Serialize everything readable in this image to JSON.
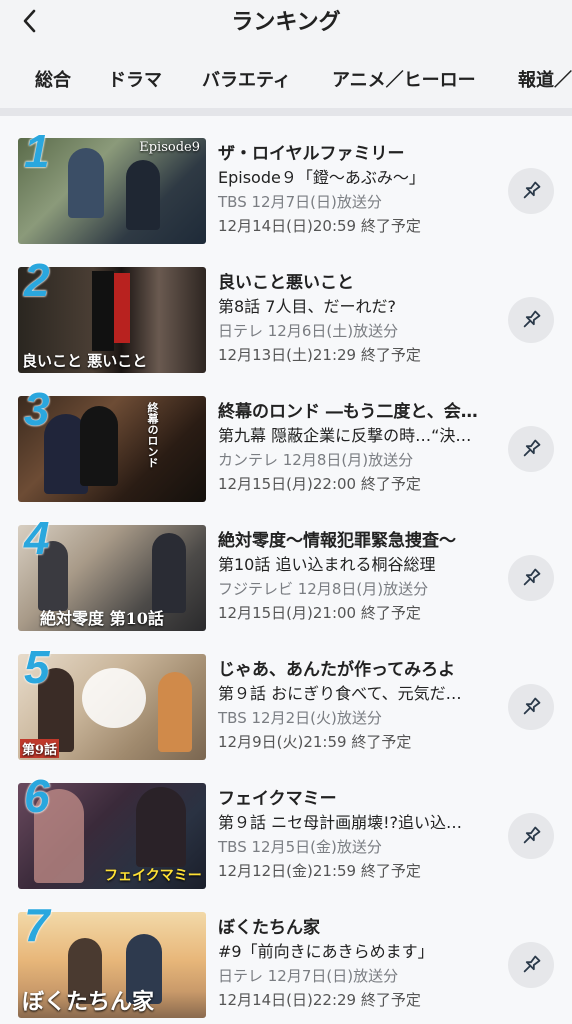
{
  "header": {
    "title": "ランキング"
  },
  "tabs": [
    {
      "label": "総合"
    },
    {
      "label": "ドラマ"
    },
    {
      "label": "バラエティ"
    },
    {
      "label": "アニメ／ヒーロー"
    },
    {
      "label": "報道／"
    }
  ],
  "active_tab": "ドラマ",
  "accent_color": "#19a4e0",
  "rank_color": "#2aa7de",
  "items": [
    {
      "rank": "1",
      "title": "ザ・ロイヤルファミリー",
      "episode": "Episode９「鐙〜あぶみ〜」",
      "broadcast": "TBS 12月7日(日)放送分",
      "expires": "12月14日(日)20:59 終了予定",
      "thumb_text": "Episode9"
    },
    {
      "rank": "2",
      "title": "良いこと悪いこと",
      "episode": "第8話 7人目、だーれだ?",
      "broadcast": "日テレ 12月6日(土)放送分",
      "expires": "12月13日(土)21:29 終了予定",
      "thumb_text": "良いこと 悪いこと"
    },
    {
      "rank": "3",
      "title": "終幕のロンド ―もう二度と、会…",
      "episode": "第九幕 隠蔽企業に反撃の時…“決…",
      "broadcast": "カンテレ 12月8日(月)放送分",
      "expires": "12月15日(月)22:00 終了予定",
      "thumb_text": "終幕のロンド"
    },
    {
      "rank": "4",
      "title": "絶対零度〜情報犯罪緊急捜査〜",
      "episode": "第10話 追い込まれる桐谷総理",
      "broadcast": "フジテレビ 12月8日(月)放送分",
      "expires": "12月15日(月)21:00 終了予定",
      "thumb_text": "絶対零度 第10話"
    },
    {
      "rank": "5",
      "title": "じゃあ、あんたが作ってみろよ",
      "episode": "第９話 おにぎり食べて、元気だ…",
      "broadcast": "TBS 12月2日(火)放送分",
      "expires": "12月9日(火)21:59 終了予定",
      "thumb_text": "第9話"
    },
    {
      "rank": "6",
      "title": "フェイクマミー",
      "episode": "第９話 ニセ母計画崩壊!?追い込…",
      "broadcast": "TBS 12月5日(金)放送分",
      "expires": "12月12日(金)21:59 終了予定",
      "thumb_text": "フェイクマミー"
    },
    {
      "rank": "7",
      "title": "ぼくたちん家",
      "episode": "#9「前向きにあきらめます」",
      "broadcast": "日テレ 12月7日(日)放送分",
      "expires": "12月14日(日)22:29 終了予定",
      "thumb_text": "ぼくたちん家"
    }
  ]
}
